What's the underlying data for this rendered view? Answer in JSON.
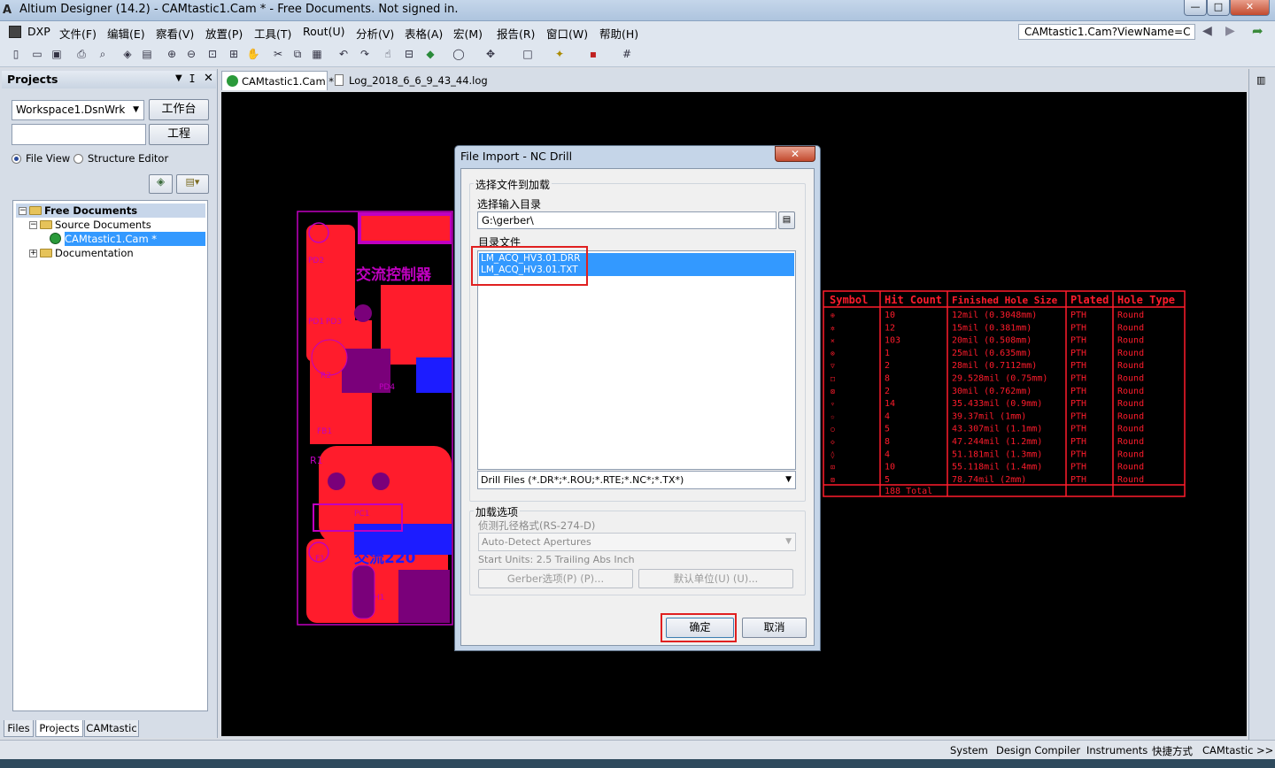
{
  "window": {
    "title": "Altium Designer (14.2) - CAMtastic1.Cam * - Free Documents. Not signed in.",
    "app_icon": "altium-logo-icon"
  },
  "menubar": {
    "items": [
      "DXP",
      "文件(F)",
      "编辑(E)",
      "察看(V)",
      "放置(P)",
      "工具(T)",
      "Rout(U)",
      "分析(V)",
      "表格(A)",
      "宏(M)",
      "报告(R)",
      "窗口(W)",
      "帮助(H)"
    ],
    "address": "CAMtastic1.Cam?ViewName=C"
  },
  "projects_panel": {
    "title": "Projects",
    "workspace": "Workspace1.DsnWrk",
    "workspace_button": "工作台",
    "project_field": "",
    "project_button": "工程",
    "radio_file_view": "File View",
    "radio_structure_editor": "Structure Editor",
    "tree": {
      "root": "Free Documents",
      "source": "Source Documents",
      "file": "CAMtastic1.Cam *",
      "documentation": "Documentation"
    },
    "bottom_tabs": [
      "Files",
      "Projects",
      "CAMtastic"
    ]
  },
  "doc_tabs": [
    "CAMtastic1.Cam *",
    "Log_2018_6_6_9_43_44.log"
  ],
  "dialog": {
    "title": "File Import - NC Drill",
    "group_select": "选择文件到加载",
    "label_dir": "选择输入目录",
    "dir_value": "G:\\gerber\\",
    "label_files": "目录文件",
    "files": [
      "LM_ACQ_HV3.01.DRR",
      "LM_ACQ_HV3.01.TXT"
    ],
    "filter": "Drill Files (*.DR*;*.ROU;*.RTE;*.NC*;*.TX*)",
    "group_load": "加载选项",
    "label_aperture": "侦测孔径格式(RS-274-D)",
    "aperture_value": "Auto-Detect Apertures",
    "start_units": "Start Units: 2.5 Trailing Abs Inch",
    "gerber_btn": "Gerber选项(P) (P)...",
    "units_btn": "默认单位(U) (U)...",
    "ok": "确定",
    "cancel": "取消"
  },
  "drill_table": {
    "headers": [
      "Symbol",
      "Hit Count",
      "Finished Hole Size",
      "Plated",
      "Hole Type"
    ],
    "rows": [
      [
        "10",
        "12mil (0.3048mm)",
        "PTH",
        "Round"
      ],
      [
        "12",
        "15mil (0.381mm)",
        "PTH",
        "Round"
      ],
      [
        "103",
        "20mil (0.508mm)",
        "PTH",
        "Round"
      ],
      [
        "1",
        "25mil (0.635mm)",
        "PTH",
        "Round"
      ],
      [
        "2",
        "28mil (0.7112mm)",
        "PTH",
        "Round"
      ],
      [
        "8",
        "29.528mil (0.75mm)",
        "PTH",
        "Round"
      ],
      [
        "2",
        "30mil (0.762mm)",
        "PTH",
        "Round"
      ],
      [
        "14",
        "35.433mil (0.9mm)",
        "PTH",
        "Round"
      ],
      [
        "4",
        "39.37mil (1mm)",
        "PTH",
        "Round"
      ],
      [
        "5",
        "43.307mil (1.1mm)",
        "PTH",
        "Round"
      ],
      [
        "8",
        "47.244mil (1.2mm)",
        "PTH",
        "Round"
      ],
      [
        "4",
        "51.181mil (1.3mm)",
        "PTH",
        "Round"
      ],
      [
        "10",
        "55.118mil (1.4mm)",
        "PTH",
        "Round"
      ],
      [
        "5",
        "78.74mil (2mm)",
        "PTH",
        "Round"
      ]
    ],
    "total": "188 Total"
  },
  "pcb_labels": [
    "PD2",
    "PD1",
    "PD3",
    "R2",
    "PD4",
    "FB1",
    "R1",
    "PC1",
    "F1",
    "H1",
    "交流控制器",
    "交流220"
  ],
  "statusbar": [
    "System",
    "Design Compiler",
    "Instruments",
    "快捷方式",
    "CAMtastic",
    ">>"
  ],
  "colors": {
    "pcb_copper": "#ff1c2c",
    "pcb_outline": "#c000c0",
    "pcb_blue": "#1c1cff",
    "highlight": "#3399ff",
    "annotation_red": "#e02020"
  }
}
